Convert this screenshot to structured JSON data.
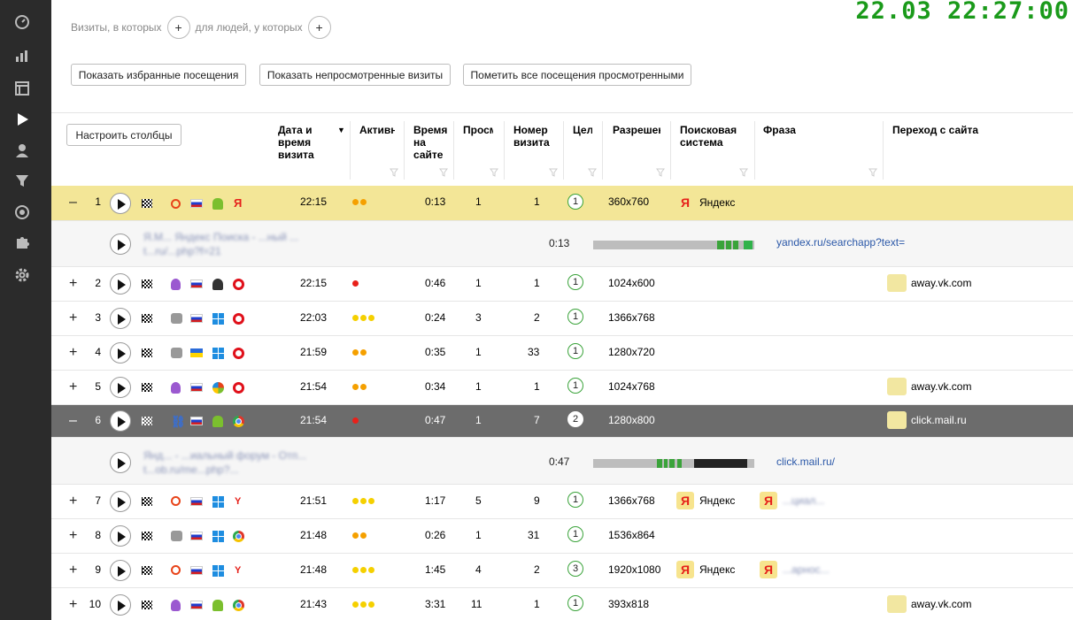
{
  "clock": "22.03 22:27:00",
  "sidebar": {
    "items": [
      "dashboard-icon",
      "bar-chart-icon",
      "layout-icon",
      "play-icon",
      "user-icon",
      "funnel-icon",
      "target-icon",
      "puzzle-icon",
      "gear-icon"
    ]
  },
  "filter": {
    "visits_label": "Визиты, в которых",
    "people_label": "для людей, у которых",
    "add": "+"
  },
  "actions": {
    "favorites": "Показать избранные посещения",
    "unviewed": "Показать непросмотренные визиты",
    "mark_all": "Пометить все посещения просмотренными"
  },
  "table": {
    "configure_button": "Настроить столбцы",
    "sort_indicator": "▼",
    "columns": {
      "datetime": "Дата и время визита",
      "activity": "Активн",
      "time_on_site": "Время на сайте",
      "views": "Просм",
      "visit_number": "Номер визита",
      "goals": "Цел",
      "resolution": "Разрешен",
      "search_engine": "Поисковая система",
      "phrase": "Фраза",
      "referer": "Переход с сайта"
    },
    "rows": [
      {
        "toggle": "–",
        "num": "1",
        "time": "22:15",
        "dur": "0:13",
        "views": "1",
        "visit": "1",
        "goal": "1",
        "res": "360x760",
        "se": "Яндекс",
        "phrase": "",
        "ref": "",
        "activity": 2
      },
      {
        "toggle": "+",
        "num": "2",
        "time": "22:15",
        "dur": "0:46",
        "views": "1",
        "visit": "1",
        "goal": "1",
        "res": "1024x600",
        "se": "",
        "phrase": "",
        "ref": "away.vk.com",
        "activity": 1
      },
      {
        "toggle": "+",
        "num": "3",
        "time": "22:03",
        "dur": "0:24",
        "views": "3",
        "visit": "2",
        "goal": "1",
        "res": "1366x768",
        "se": "",
        "phrase": "",
        "ref": "",
        "activity": 3
      },
      {
        "toggle": "+",
        "num": "4",
        "time": "21:59",
        "dur": "0:35",
        "views": "1",
        "visit": "33",
        "goal": "1",
        "res": "1280x720",
        "se": "",
        "phrase": "",
        "ref": "",
        "activity": 2
      },
      {
        "toggle": "+",
        "num": "5",
        "time": "21:54",
        "dur": "0:34",
        "views": "1",
        "visit": "1",
        "goal": "1",
        "res": "1024x768",
        "se": "",
        "phrase": "",
        "ref": "away.vk.com",
        "activity": 2
      },
      {
        "toggle": "–",
        "num": "6",
        "time": "21:54",
        "dur": "0:47",
        "views": "1",
        "visit": "7",
        "goal": "2",
        "res": "1280x800",
        "se": "",
        "phrase": "",
        "ref": "click.mail.ru",
        "activity": 1
      },
      {
        "toggle": "+",
        "num": "7",
        "time": "21:51",
        "dur": "1:17",
        "views": "5",
        "visit": "9",
        "goal": "1",
        "res": "1366x768",
        "se": "Яндекс",
        "phrase": "...циал...",
        "ref": "",
        "activity": 3
      },
      {
        "toggle": "+",
        "num": "8",
        "time": "21:48",
        "dur": "0:26",
        "views": "1",
        "visit": "31",
        "goal": "1",
        "res": "1536x864",
        "se": "",
        "phrase": "",
        "ref": "",
        "activity": 2
      },
      {
        "toggle": "+",
        "num": "9",
        "time": "21:48",
        "dur": "1:45",
        "views": "4",
        "visit": "2",
        "goal": "3",
        "res": "1920x1080",
        "se": "Яндекс",
        "phrase": "...арнос...",
        "ref": "",
        "activity": 3
      },
      {
        "toggle": "+",
        "num": "10",
        "time": "21:43",
        "dur": "3:31",
        "views": "11",
        "visit": "1",
        "goal": "1",
        "res": "393x818",
        "se": "",
        "phrase": "",
        "ref": "away.vk.com",
        "activity": 3
      }
    ],
    "subrows": [
      {
        "title": "Я.М... Яндекс Поиска - ...ный ...",
        "link": "t...ru/...php?f=21",
        "time": "0:13",
        "ref": "yandex.ru/searchapp?text="
      },
      {
        "title": "Янд... - ...иальный форум - Отп...",
        "link": "t...ob.ru/me...php?...",
        "time": "0:47",
        "ref": "click.mail.ru/"
      }
    ]
  },
  "colors": {
    "highlight_row": "#f3e697",
    "dark_row": "#6c6c6c",
    "clock": "#1a9a1a",
    "activity_red": "#e8201a",
    "activity_orange": "#f5a000",
    "activity_yellow": "#f5d000"
  }
}
